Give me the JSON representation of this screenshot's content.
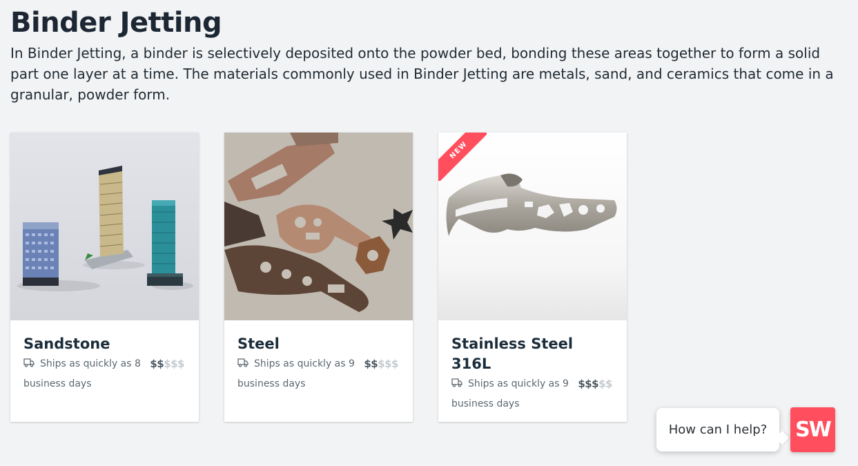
{
  "page": {
    "title": "Binder Jetting",
    "description": "In Binder Jetting, a binder is selectively deposited onto the powder bed, bonding these areas together to form a solid part one layer at a time. The materials commonly used in Binder Jetting are metals, sand, and ceramics that come in a granular, powder form."
  },
  "materials": [
    {
      "name": "Sandstone",
      "ship_text": "Ships as quickly as 8 business days",
      "price_on": "$$",
      "price_off": "$$$",
      "image": "miniature-buildings-photo"
    },
    {
      "name": "Steel",
      "ship_text": "Ships as quickly as 9 business days",
      "price_on": "$$",
      "price_off": "$$$",
      "image": "metal-tools-photo"
    },
    {
      "name": "Stainless Steel 316L",
      "ship_text": "Ships as quickly as 9 business days",
      "price_on": "$$$",
      "price_off": "$$",
      "image": "steel-wrench-photo",
      "badge": "NEW"
    }
  ],
  "chat": {
    "prompt": "How can I help?",
    "logo_text": "SW"
  },
  "colors": {
    "background": "#f2f3f5",
    "accent": "#ff4f5e",
    "price_active": "#4c5963",
    "price_inactive": "#c4cbd0"
  }
}
